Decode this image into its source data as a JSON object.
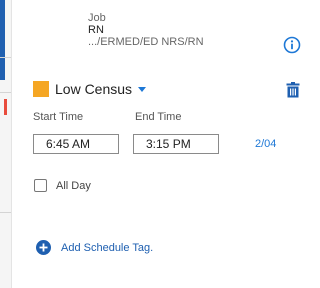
{
  "job": {
    "label": "Job",
    "title": "RN",
    "path": ".../ERMED/ED NRS/RN"
  },
  "icons": {
    "info": "info-circle-icon",
    "trash": "trash-icon",
    "caret": "caret-down-icon",
    "add": "plus-circle-icon"
  },
  "census": {
    "label": "Low Census",
    "color": "#f5a623"
  },
  "time": {
    "start_label": "Start Time",
    "end_label": "End Time",
    "start_value": "6:45 AM",
    "end_value": "3:15 PM",
    "date_link": "2/04"
  },
  "all_day": {
    "label": "All Day",
    "checked": false
  },
  "add_tag": {
    "label": "Add Schedule Tag."
  },
  "colors": {
    "accent_blue": "#1e78d6",
    "sidebar_blue": "#1f5fb0"
  }
}
